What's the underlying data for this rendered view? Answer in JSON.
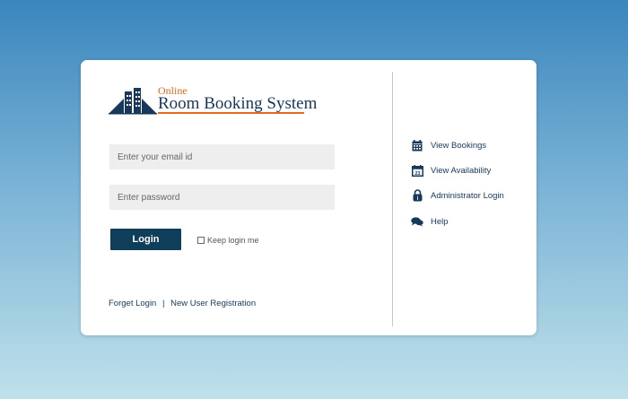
{
  "logo": {
    "online": "Online",
    "title": "Room Booking System"
  },
  "form": {
    "email_placeholder": "Enter your email id",
    "password_placeholder": "Enter password",
    "login_label": "Login",
    "keep_login_label": "Keep login me"
  },
  "links": {
    "forget_login": "Forget Login",
    "separator": "|",
    "new_user_registration": "New User Registration"
  },
  "side_menu": {
    "items": [
      {
        "label": "View Bookings",
        "icon": "calendar-icon"
      },
      {
        "label": "View Availability",
        "icon": "calendar-date-icon",
        "icon_text": "23"
      },
      {
        "label": "Administrator Login",
        "icon": "lock-icon",
        "icon_text": "i"
      },
      {
        "label": "Help",
        "icon": "chat-bubbles-icon"
      }
    ]
  },
  "colors": {
    "accent_orange": "#e06b1f",
    "navy": "#17385a",
    "button": "#0e3e5a"
  }
}
